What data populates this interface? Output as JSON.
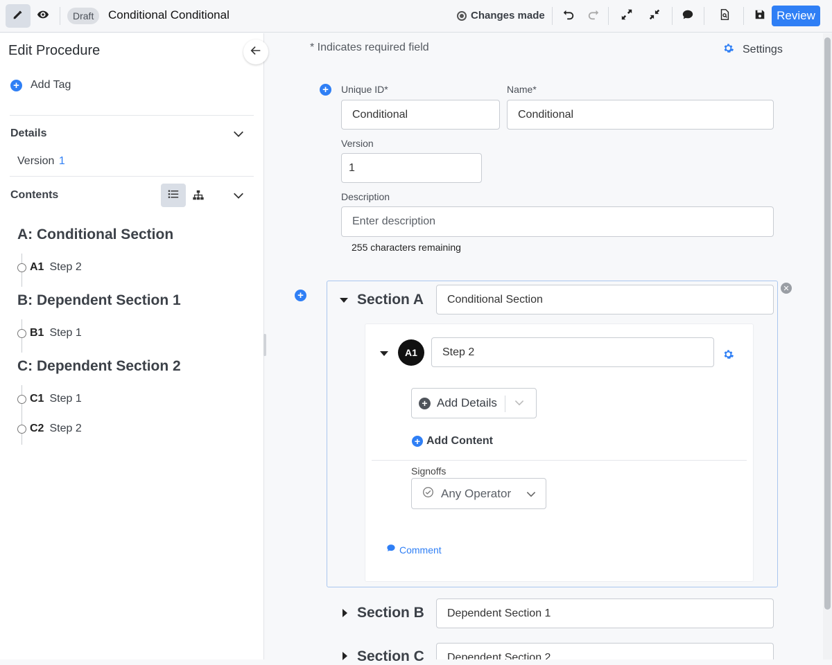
{
  "toolbar": {
    "draft_badge": "Draft",
    "procedure_title": "Conditional Conditional",
    "changes_status": "Changes made",
    "review_label": "Review"
  },
  "sidebar": {
    "title": "Edit Procedure",
    "add_tag": "Add Tag",
    "details_label": "Details",
    "version_label": "Version",
    "version_value": "1",
    "contents_label": "Contents",
    "outline": [
      {
        "title": "A: Conditional Section",
        "steps": [
          {
            "id": "A1",
            "name": "Step 2"
          }
        ]
      },
      {
        "title": "B: Dependent Section 1",
        "steps": [
          {
            "id": "B1",
            "name": "Step 1"
          }
        ]
      },
      {
        "title": "C: Dependent Section 2",
        "steps": [
          {
            "id": "C1",
            "name": "Step 1"
          },
          {
            "id": "C2",
            "name": "Step 2"
          }
        ]
      }
    ]
  },
  "main": {
    "required_note": "* Indicates required field",
    "settings_label": "Settings",
    "unique_id_label": "Unique ID*",
    "unique_id_value": "Conditional",
    "name_label": "Name*",
    "name_value": "Conditional",
    "version_label": "Version",
    "version_value": "1",
    "description_label": "Description",
    "description_placeholder": "Enter description",
    "chars_remaining": "255 characters remaining",
    "sections": [
      {
        "label": "Section A",
        "name": "Conditional Section"
      },
      {
        "label": "Section B",
        "name": "Dependent Section 1"
      },
      {
        "label": "Section C",
        "name": "Dependent Section 2"
      }
    ],
    "step": {
      "badge": "A1",
      "name": "Step 2",
      "add_details": "Add Details",
      "add_content": "Add Content",
      "signoffs_label": "Signoffs",
      "signoff_value": "Any Operator",
      "comment_label": "Comment"
    }
  },
  "colors": {
    "accent": "#2f7ff5",
    "section_border": "#a9c6ee",
    "badge_bg": "#111111"
  }
}
